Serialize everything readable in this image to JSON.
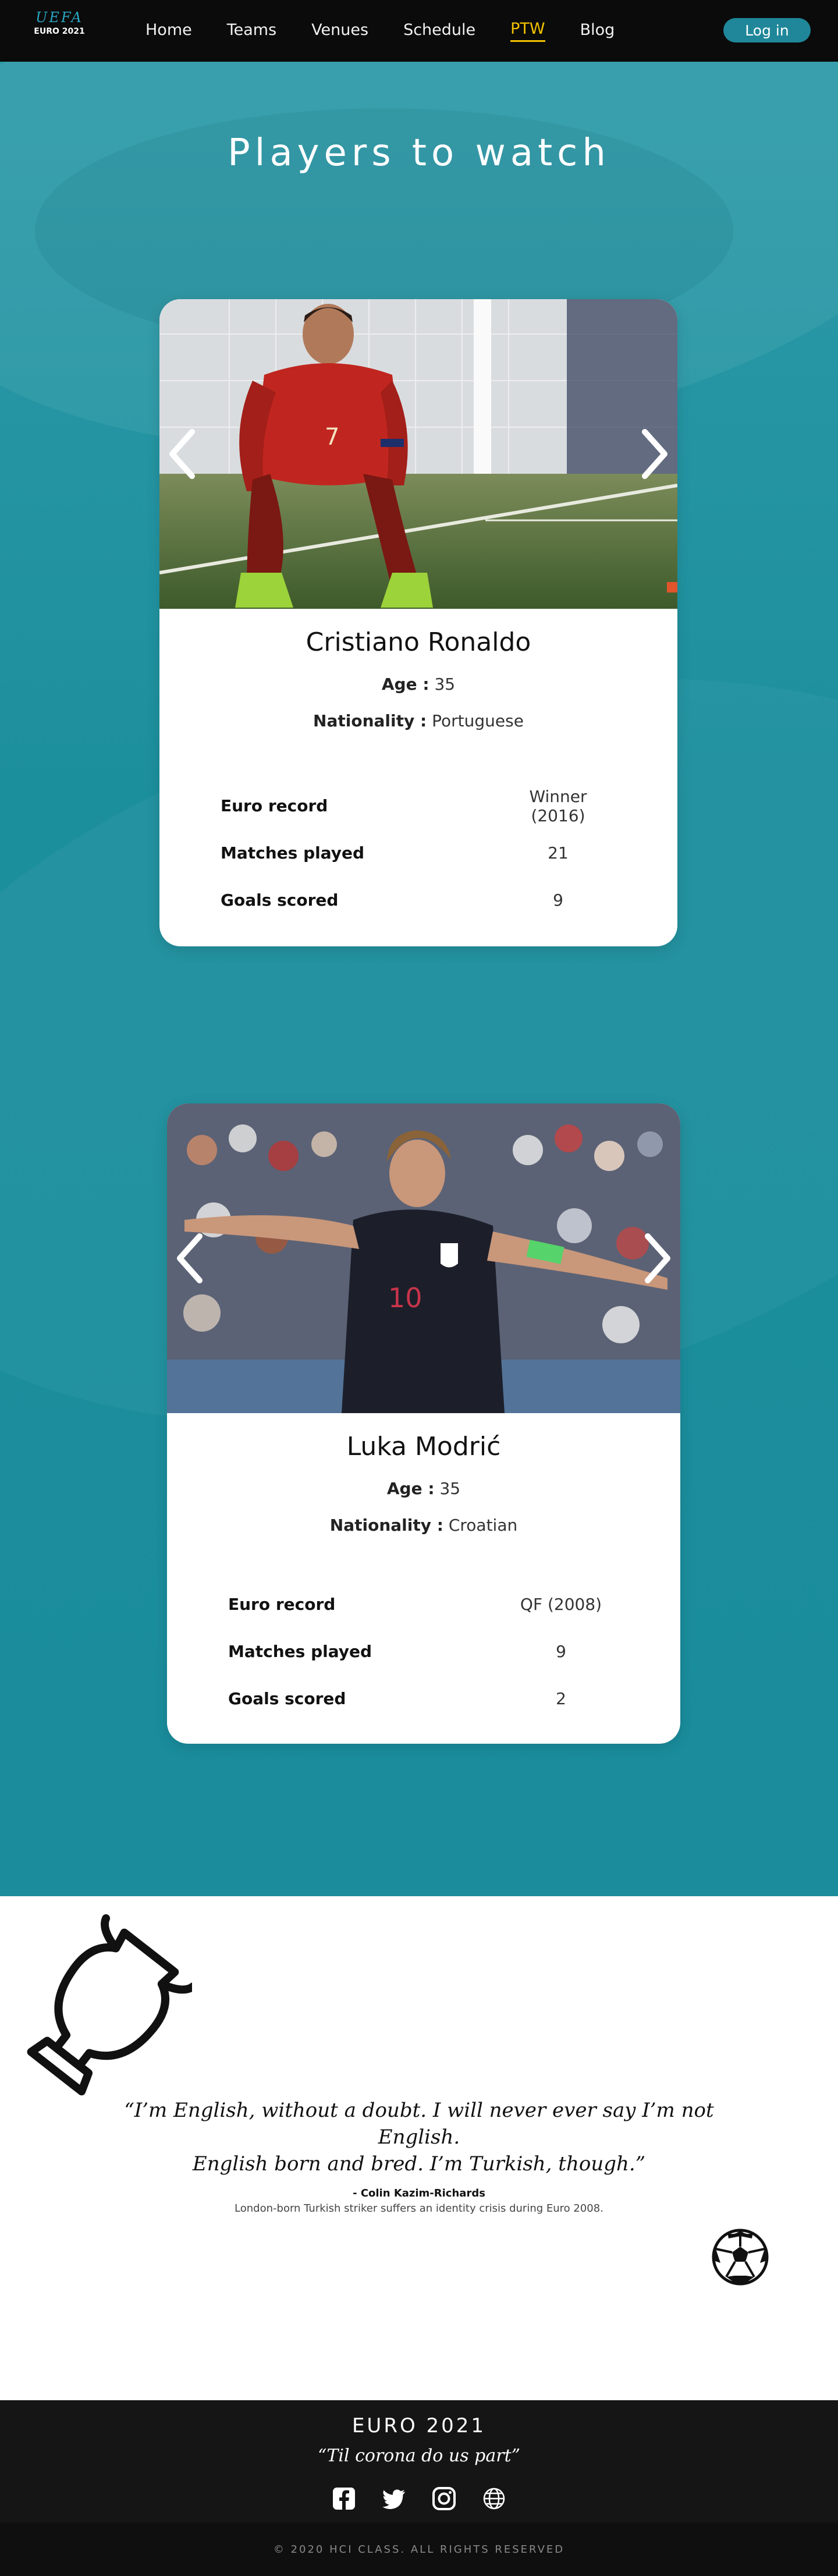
{
  "nav": {
    "logo_mark": "UEFA",
    "logo_sub": "EURO 2021",
    "links": [
      {
        "label": "Home"
      },
      {
        "label": "Teams"
      },
      {
        "label": "Venues"
      },
      {
        "label": "Schedule"
      },
      {
        "label": "PTW",
        "active": true
      },
      {
        "label": "Blog"
      }
    ],
    "login_label": "Log in"
  },
  "page": {
    "title": "Players to watch"
  },
  "players": [
    {
      "name": "Cristiano Ronaldo",
      "age_label": "Age :",
      "age": "35",
      "nationality_label": "Nationality :",
      "nationality": "Portuguese",
      "stats": [
        {
          "label": "Euro record",
          "value": "Winner (2016)"
        },
        {
          "label": "Matches played",
          "value": "21"
        },
        {
          "label": "Goals scored",
          "value": "9"
        }
      ]
    },
    {
      "name": "Luka Modrić",
      "age_label": "Age :",
      "age": "35",
      "nationality_label": "Nationality :",
      "nationality": "Croatian",
      "stats": [
        {
          "label": "Euro record",
          "value": "QF (2008)"
        },
        {
          "label": "Matches played",
          "value": "9"
        },
        {
          "label": "Goals scored",
          "value": "2"
        }
      ]
    }
  ],
  "quote": {
    "line1": "“I’m English, without a doubt. I will never ever say I’m not English.",
    "line2": "English born and bred. I’m Turkish, though.”",
    "author": "- Colin Kazim-Richards",
    "context": "London-born Turkish striker  suffers an identity crisis during Euro 2008."
  },
  "footer": {
    "title": "EURO 2021",
    "tagline": "“Til corona do us part”",
    "social_icons": [
      "facebook-icon",
      "twitter-icon",
      "instagram-icon",
      "globe-icon"
    ],
    "copyright": "© 2020 HCI CLASS. ALL RIGHTS RESERVED"
  },
  "colors": {
    "nav_bg": "#0b0b0b",
    "accent_active": "#f2c200",
    "teal_bg": "#1a8c9c",
    "login_btn": "#1f8799",
    "footer_bg": "#151515"
  }
}
